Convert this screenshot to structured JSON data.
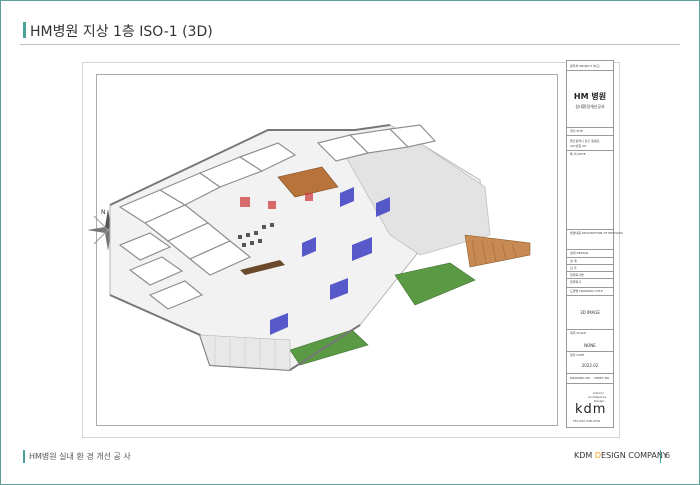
{
  "header": {
    "title": "HM병원 지상 1층 ISO-1 (3D)"
  },
  "title_block": {
    "project_label": "발주처 PROJECT 부/교",
    "client_name": "HM 병원",
    "client_subtitle": "실내환경개선공사",
    "location_label": "위치 SITE",
    "location_lines": [
      "울산광역시 남구 동평로",
      "167번길 28"
    ],
    "note_label": "특 이 NOTE",
    "description_label": "변경내용 DESCRIPTION OF REVISION",
    "design_label": "설계 DESIGN",
    "design_rows": [
      "설 계",
      "감 리",
      "협력회사명",
      "협력회사"
    ],
    "drawing_title_label": "도면명 DRAWING TITLE",
    "drawing_title": "3D IMAGE",
    "scale_label": "축척 SCALE",
    "scale_value": "NONE",
    "date_label": "일자 DATE",
    "date_value": "2022.02",
    "drawing_no_label": "DRAWING NO",
    "sheet_no_label": "SHEET NO",
    "company_lines": [
      "Interior",
      "Architecture",
      "Design"
    ],
    "logo_text": "kdm",
    "phone": "TEL.052-248-9761"
  },
  "compass": {
    "north_label": "N"
  },
  "footer": {
    "left": "HM병원 실내 환 경 개선 공 사",
    "company_pre": "KDM ",
    "company_o": "D",
    "company_post": "ESIGN COMPANY",
    "page_number": "6"
  },
  "colors": {
    "accent": "#4aa39b",
    "brand_orange": "#f2a51a",
    "glass_blue": "#3c3fc4",
    "grass_green": "#4f8a3c",
    "wood": "#b8733a"
  }
}
